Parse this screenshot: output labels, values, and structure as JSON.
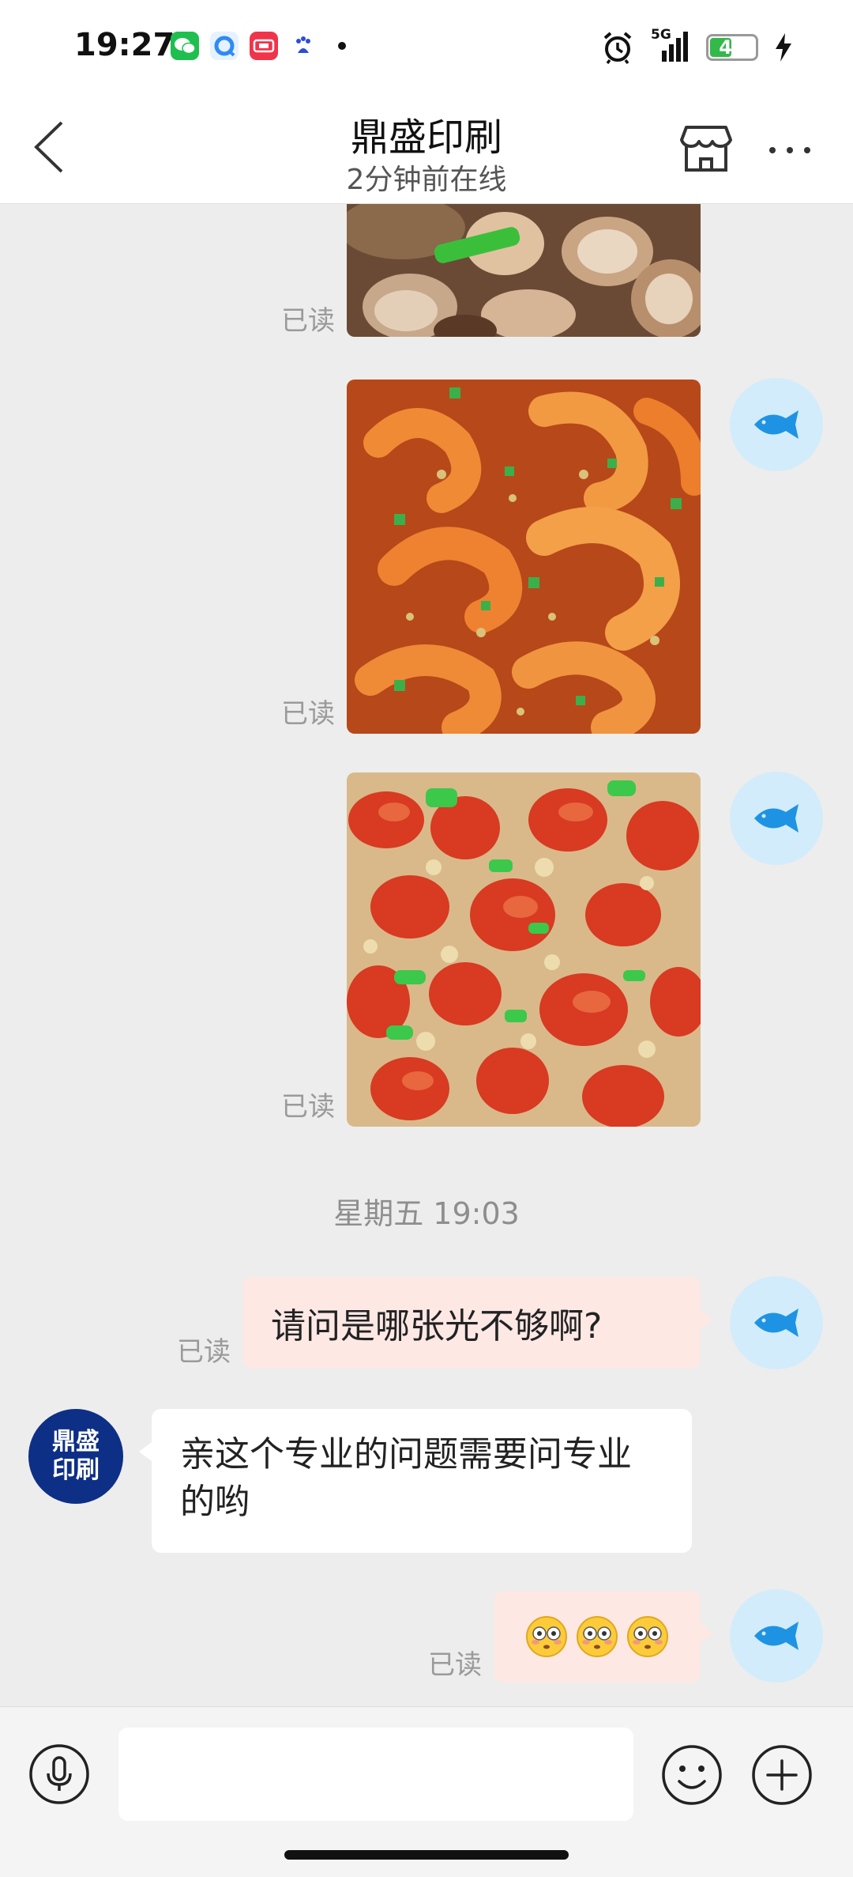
{
  "status_bar": {
    "time": "19:27",
    "network": "5G",
    "battery": "48",
    "battery_fraction": 0.48,
    "icons": [
      "wechat-icon",
      "browser-icon",
      "shopping-icon",
      "baidu-icon",
      "alarm-icon",
      "signal-icon",
      "battery-icon",
      "charging-icon"
    ]
  },
  "header": {
    "title": "鼎盛印刷",
    "subtitle": "2分钟前在线",
    "icons": [
      "back-chevron-icon",
      "shop-icon",
      "more-dots-icon"
    ]
  },
  "messages": [
    {
      "type": "image",
      "from": "me",
      "subject": "clams dish",
      "read_label": "已读"
    },
    {
      "type": "image",
      "from": "me",
      "subject": "shrimp dish",
      "read_label": "已读"
    },
    {
      "type": "image",
      "from": "me",
      "subject": "crayfish dish",
      "read_label": "已读"
    }
  ],
  "divider": "星期五 19:03",
  "text_messages": {
    "me_1": {
      "text": "请问是哪张光不够啊?",
      "read_label": "已读"
    },
    "them_1": {
      "text": "亲这个专业的问题需要问专业的哟",
      "avatar_text": "鼎盛印刷"
    },
    "me_2": {
      "emoji": [
        "flushed-face-emoji",
        "flushed-face-emoji",
        "flushed-face-emoji"
      ],
      "read_label": "已读"
    }
  },
  "colors": {
    "background": "#ededed",
    "my_bubble": "#fde8e4",
    "their_bubble": "#ffffff",
    "my_avatar": "#d2ecfb",
    "fish": "#1f93e3",
    "shop_avatar": "#0d2f86"
  },
  "input_bar": {
    "placeholder": "",
    "icons": [
      "microphone-icon",
      "emoji-icon",
      "plus-icon"
    ]
  }
}
